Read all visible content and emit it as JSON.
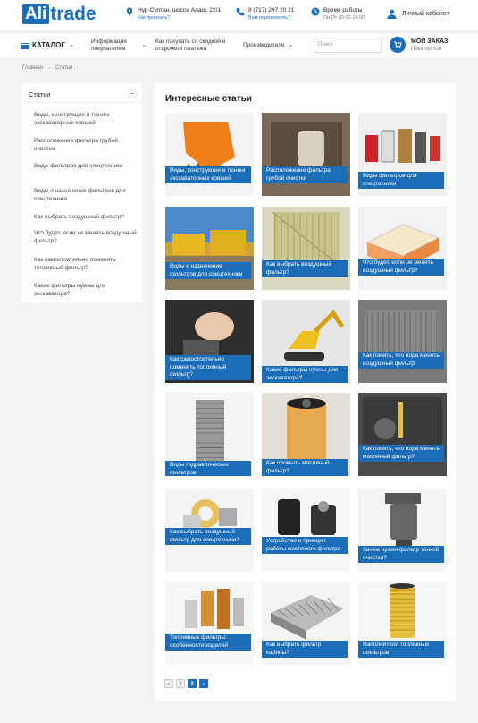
{
  "header": {
    "logo_box": "Ali",
    "logo_text": "trade",
    "address": "Нур-Султан, шоссе Алаш, 22/1",
    "address_link": "Как проехать?",
    "phone": "8 (717) 297 20 21",
    "phone_link": "Вам перезвонить?",
    "hours_title": "Время работы",
    "hours_value": "Пн-Пт 09:00-18:00",
    "cabinet": "Личный кабинет"
  },
  "nav": {
    "catalog": "КАТАЛОГ",
    "info": "Информация покупателям",
    "credit": "Как покупать со скидкой и отсрочкой платежа",
    "manufacturers": "Производители",
    "search_placeholder": "Поиск",
    "order_title": "МОЙ ЗАКАЗ",
    "order_sub": "Пока пустой"
  },
  "breadcrumb": {
    "home": "Главная",
    "sep": "→",
    "current": "Статьи"
  },
  "sidebar": {
    "title": "Статьи",
    "toggle": "−",
    "items": [
      {
        "label": "Виды, конструкция и тюнинг экскаваторных ковшей"
      },
      {
        "label": "Расположение фильтра грубой очистки"
      },
      {
        "label": "Виды фильтров для спецтехники"
      },
      {
        "label": "Виды и назначение фильтров для спецтехники"
      },
      {
        "label": "Как выбрать воздушный фильтр?"
      },
      {
        "label": "Что будет, если не менять воздушный фильтр?"
      },
      {
        "label": "Как самостоятельно поменять топливный фильтр?"
      },
      {
        "label": "Какие фильтры нужны для экскаватора?"
      }
    ]
  },
  "content": {
    "title": "Интересные статьи",
    "cards": [
      {
        "label": "Виды, конструкция и тюнинг экскаваторных ковшей",
        "icon": "bucket-image"
      },
      {
        "label": "Расположение фильтра грубой очистки",
        "icon": "engine-image"
      },
      {
        "label": "Виды фильтров для спецтехники",
        "icon": "filters-image"
      },
      {
        "label": "Виды и назначение фильтров для спецтехники",
        "icon": "machinery-image"
      },
      {
        "label": "Как выбрать воздушный фильтр?",
        "icon": "panel-filter-image"
      },
      {
        "label": "Что будет, если не менять воздушный фильтр?",
        "icon": "air-filter-image"
      },
      {
        "label": "Как самостоятельно поменять топливный фильтр?",
        "icon": "hands-engine-image"
      },
      {
        "label": "Какие фильтры нужны для экскаватора?",
        "icon": "excavator-image"
      },
      {
        "label": "Как понять, что пора менять воздушный фильтр",
        "icon": "dirty-filter-image"
      },
      {
        "label": "Виды гидравлических фильтров",
        "icon": "hydraulic-filter-image"
      },
      {
        "label": "Как промыть масляный фильтр?",
        "icon": "oil-filter-image"
      },
      {
        "label": "Как понять, что пора менять масляный фильтр?",
        "icon": "oil-engine-image"
      },
      {
        "label": "Как выбрать воздушный фильтр для спецтехники?",
        "icon": "round-filters-image"
      },
      {
        "label": "Устройство и принцип работы масляного фильтра",
        "icon": "spin-filter-image"
      },
      {
        "label": "Зачем нужен фильтр тонкой очистки?",
        "icon": "fuel-filter-image"
      },
      {
        "label": "Топливные фильтры: особенности изделий",
        "icon": "fuel-filters-image"
      },
      {
        "label": "Как выбрать фильтр кабины?",
        "icon": "cabin-filter-image"
      },
      {
        "label": "Наполнители топливных фильтров",
        "icon": "cartridge-image"
      }
    ]
  },
  "pager": {
    "prev": "‹",
    "page1": "1",
    "page2": "2",
    "next": "›"
  },
  "colors": {
    "accent": "#1b6db8"
  }
}
